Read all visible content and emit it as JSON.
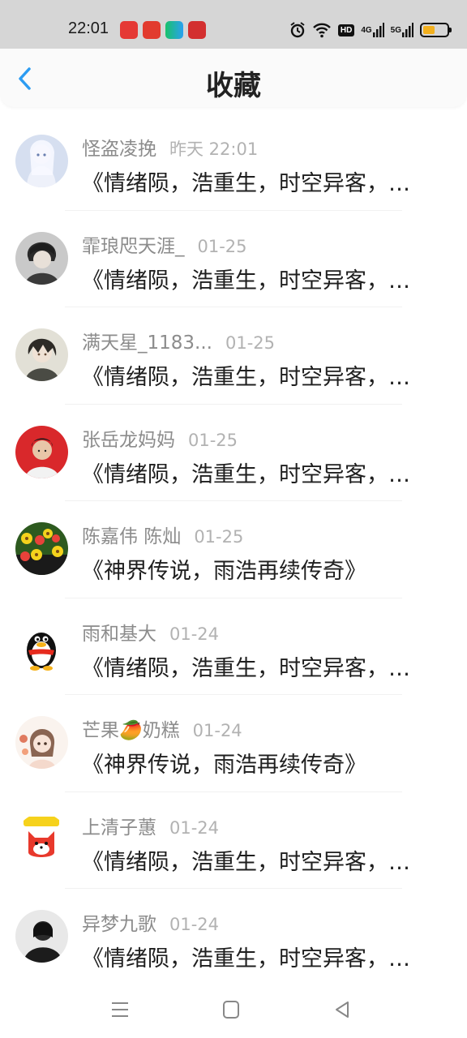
{
  "status_bar": {
    "time": "22:01",
    "hd_label": "HD",
    "net1_label": "4G",
    "net2_label": "5G",
    "battery_level_percent": 50,
    "app_icons": [
      {
        "name": "app-icon-1",
        "color": "#e53935"
      },
      {
        "name": "app-icon-2",
        "color": "#e23b2e"
      },
      {
        "name": "iqiyi-icon",
        "color": "#19c26b"
      },
      {
        "name": "app-icon-4",
        "color": "#d32f2f"
      }
    ]
  },
  "header": {
    "title": "收藏"
  },
  "colors": {
    "accent": "#2c9cf2",
    "name_gray": "#8c8c8c",
    "time_gray": "#b2b2b2"
  },
  "items": [
    {
      "name": "怪盗凌挽",
      "time": "昨天 22:01",
      "desc": "《情绪陨，浩重生，时空异客，千年之前》",
      "avatar": "girl-white-hair-avatar"
    },
    {
      "name": "霏琅咫天涯_",
      "time": "01-25",
      "desc": "《情绪陨，浩重生，时空异客，千年之前》",
      "avatar": "dark-hair-boy-avatar"
    },
    {
      "name": "满天星_1183...",
      "time": "01-25",
      "desc": "《情绪陨，浩重生，时空异客，千年之前》",
      "avatar": "anime-boy-avatar"
    },
    {
      "name": "张岳龙妈妈",
      "time": "01-25",
      "desc": "《情绪陨，浩重生，时空异客，千年之前》",
      "avatar": "photo-portrait-avatar"
    },
    {
      "name": "陈嘉伟 陈灿",
      "time": "01-25",
      "desc": "《神界传说，雨浩再续传奇》",
      "avatar": "flowers-avatar"
    },
    {
      "name": "雨和基大",
      "time": "01-24",
      "desc": "《情绪陨，浩重生，时空异客，千年之前》",
      "avatar": "qq-penguin-avatar"
    },
    {
      "name": "芒果🥭奶糕",
      "time": "01-24",
      "desc": "《神界传说，雨浩再续传奇》",
      "avatar": "cartoon-girl-avatar"
    },
    {
      "name": "上清子蕙",
      "time": "01-24",
      "desc": "《情绪陨，浩重生，时空异客，千年之前》",
      "avatar": "cartoon-fox-avatar"
    },
    {
      "name": "异梦九歌",
      "time": "01-24",
      "desc": "《情绪陨，浩重生，时空异客，千年之前》",
      "avatar": "dark-figure-avatar"
    }
  ],
  "nav": {
    "menu_icon": "menu-icon",
    "home_icon": "home-icon",
    "back_icon": "back-triangle-icon"
  }
}
